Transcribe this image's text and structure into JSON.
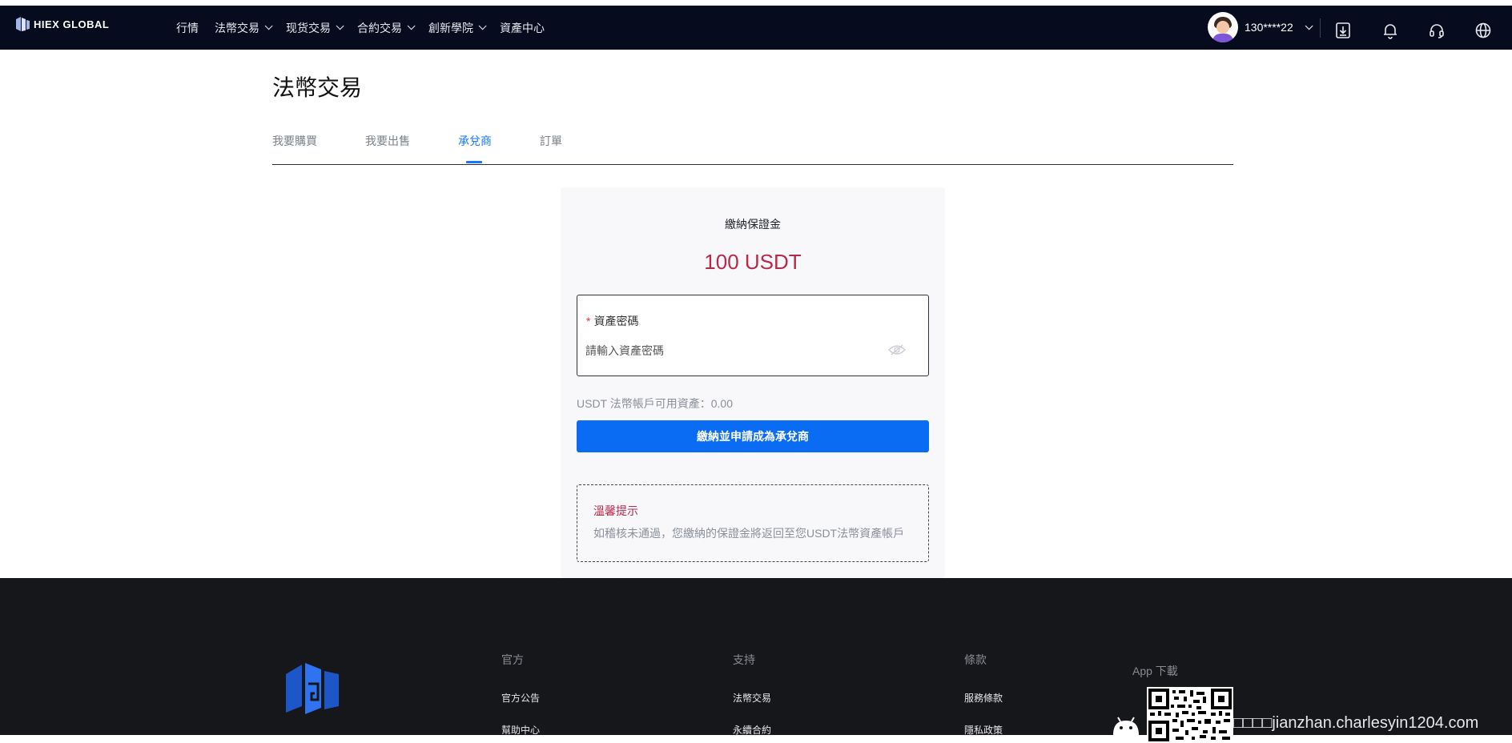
{
  "header": {
    "logo_text": "HIEX GLOBAL",
    "nav": [
      {
        "label": "行情",
        "has_dropdown": false
      },
      {
        "label": "法幣交易",
        "has_dropdown": true
      },
      {
        "label": "现货交易",
        "has_dropdown": true
      },
      {
        "label": "合約交易",
        "has_dropdown": true
      },
      {
        "label": "創新學院",
        "has_dropdown": true
      },
      {
        "label": "資產中心",
        "has_dropdown": false
      }
    ],
    "user_name": "130****22",
    "icons": [
      "download-icon",
      "bell-icon",
      "headset-icon",
      "globe-icon"
    ]
  },
  "page": {
    "title": "法幣交易",
    "tabs": [
      {
        "label": "我要購買"
      },
      {
        "label": "我要出售"
      },
      {
        "label": "承兌商",
        "active": true
      },
      {
        "label": "訂單"
      }
    ]
  },
  "deposit": {
    "title": "繳納保證金",
    "amount": "100 USDT",
    "password_label": "資產密碼",
    "required_mark": "*",
    "password_placeholder": "請輸入資產密碼",
    "password_value": "",
    "balance_text": "USDT 法幣帳戶可用資產：0.00",
    "submit_label": "繳納並申請成為承兌商",
    "tip_title": "溫馨提示",
    "tip_text": "如稽核未通過，您繳納的保證金將返回至您USDT法幣資產帳戶",
    "accent_color": "#b8284a",
    "button_color": "#0a6cf2"
  },
  "footer": {
    "columns": [
      {
        "title": "官方",
        "links": [
          "官方公告",
          "幫助中心"
        ]
      },
      {
        "title": "支持",
        "links": [
          "法幣交易",
          "永續合約"
        ]
      },
      {
        "title": "條款",
        "links": [
          "服務條款",
          "隱私政策"
        ]
      }
    ],
    "app_title": "App 下載",
    "watermark": "□□□□jianzhan.charlesyin1204.com"
  }
}
